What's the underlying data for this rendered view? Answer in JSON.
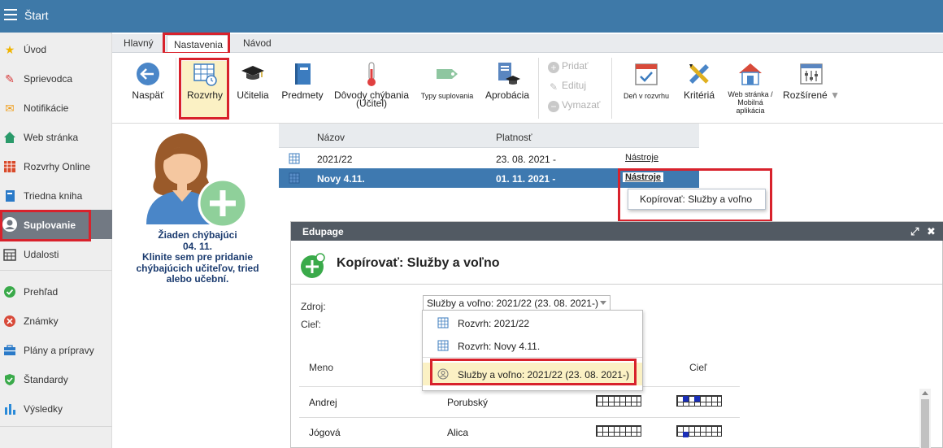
{
  "app": {
    "title": "Štart"
  },
  "sidebar": {
    "items": [
      {
        "label": "Úvod",
        "icon": "star-icon",
        "color": "#f0b400"
      },
      {
        "label": "Sprievodca",
        "icon": "magic-wand-icon",
        "color": "#d83a3a"
      },
      {
        "label": "Notifikácie",
        "icon": "envelope-icon",
        "color": "#f0a020"
      },
      {
        "label": "Web stránka",
        "icon": "house-icon",
        "color": "#2a9a6a"
      },
      {
        "label": "Rozvrhy Online",
        "icon": "timetable-icon",
        "color": "#d84a2a"
      },
      {
        "label": "Triedna kniha",
        "icon": "book-icon",
        "color": "#2a7ac8"
      },
      {
        "label": "Suplovanie",
        "icon": "user-circle-icon",
        "color": "#ffffff"
      },
      {
        "label": "Udalosti",
        "icon": "calendar-icon",
        "color": "#444444"
      },
      {
        "label": "Prehľad",
        "icon": "check-circle-icon",
        "color": "#3aaa4a"
      },
      {
        "label": "Známky",
        "icon": "grade-icon",
        "color": "#d84a3a"
      },
      {
        "label": "Plány a prípravy",
        "icon": "briefcase-icon",
        "color": "#2a7ac8"
      },
      {
        "label": "Štandardy",
        "icon": "shield-check-icon",
        "color": "#3aaa4a"
      },
      {
        "label": "Výsledky",
        "icon": "bar-chart-icon",
        "color": "#2a8ad8"
      }
    ]
  },
  "tabs": [
    {
      "label": "Hlavný"
    },
    {
      "label": "Nastavenia"
    },
    {
      "label": "Návod"
    }
  ],
  "toolbar": {
    "back": "Naspäť",
    "timetables": "Rozvrhy",
    "teachers": "Učitelia",
    "subjects": "Predmety",
    "absence_reasons": "Dôvody chýbania",
    "absence_reasons_sub": "(Učitel)",
    "substitution_types": "Typy suplovania",
    "approbation": "Aprobácia",
    "add": "Pridať",
    "edit": "Edituj",
    "delete": "Vymazať",
    "day_in_timetable": "Deň v rozvrhu",
    "criteria": "Kritériá",
    "web_mobile_1": "Web stránka /",
    "web_mobile_2": "Mobilná",
    "web_mobile_3": "aplikácia",
    "extended": "Rozšírené"
  },
  "absent_panel": {
    "line1": "Žiaden chýbajúci",
    "line2": "04. 11.",
    "line3": "Klinite sem pre pridanie",
    "line4": "chýbajúcich učiteľov, tried",
    "line5": "alebo učební."
  },
  "timetables_table": {
    "headers": {
      "name": "Názov",
      "validity": "Platnosť"
    },
    "rows": [
      {
        "name": "2021/22",
        "validity": "23. 08. 2021 -",
        "tools": "Nástroje"
      },
      {
        "name": "Novy 4.11.",
        "validity": "01. 11. 2021 -",
        "tools": "Nástroje"
      }
    ],
    "context_menu_item": "Kopírovať: Služby a voľno"
  },
  "dialog": {
    "window_title": "Edupage",
    "heading": "Kopírovať: Služby a voľno",
    "source_label": "Zdroj:",
    "target_label": "Cieľ:",
    "source_value": "Služby a voľno: 2021/22 (23. 08. 2021-)",
    "dropdown_options": [
      {
        "label": "Rozvrh: 2021/22"
      },
      {
        "label": "Rozvrh: Novy 4.11."
      },
      {
        "label": "Služby a voľno: 2021/22 (23. 08. 2021-)"
      }
    ],
    "columns": {
      "name": "Meno",
      "target": "Cieľ"
    },
    "rows": [
      {
        "first": "Andrej",
        "last": "Porubský"
      },
      {
        "first": "Jógová",
        "last": "Alica"
      }
    ]
  },
  "colors": {
    "topbar": "#3e79a8",
    "selected_row": "#3e79b0",
    "highlight_red": "#d8222c",
    "dialog_titlebar": "#525a63"
  }
}
